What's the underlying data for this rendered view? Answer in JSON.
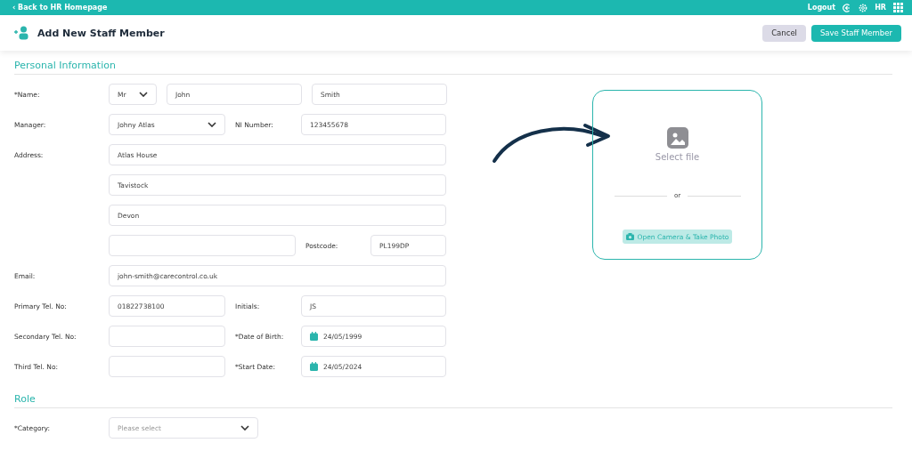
{
  "top_bar": {
    "back_link": "‹ Back to HR Homepage",
    "logout": "Logout",
    "user": "HR"
  },
  "header": {
    "title": "Add New Staff Member",
    "buttons": [
      {
        "label": "Cancel",
        "kind": "secondary"
      },
      {
        "label": "Save Staff Member",
        "kind": "primary"
      }
    ]
  },
  "sections": [
    {
      "title": "Personal Information",
      "rows": [
        {
          "kind": "name",
          "label": "*Name:",
          "fields": [
            {
              "kind": "select",
              "value": "Mr"
            },
            {
              "kind": "input",
              "value": "John"
            },
            {
              "kind": "input",
              "value": "Smith"
            }
          ]
        },
        {
          "kind": "pair",
          "label": "Manager:",
          "fields": [
            {
              "kind": "select",
              "value": "Johny Atlas"
            }
          ],
          "extra": {
            "label": "NI Number:",
            "field": {
              "kind": "input",
              "value": "123455678"
            }
          }
        },
        {
          "kind": "full",
          "label": "Address:",
          "fields": [
            {
              "kind": "input",
              "value": "Atlas House"
            }
          ]
        },
        {
          "kind": "full",
          "fields": [
            {
              "kind": "input",
              "value": "Tavistock"
            }
          ]
        },
        {
          "kind": "full",
          "fields": [
            {
              "kind": "input",
              "value": "Devon"
            }
          ]
        },
        {
          "kind": "postcode",
          "fields": [
            {
              "kind": "input"
            }
          ],
          "extra": {
            "label": "Postcode:",
            "field": {
              "kind": "input",
              "value": "PL199DP"
            }
          }
        },
        {
          "kind": "full",
          "label": "Email:",
          "fields": [
            {
              "kind": "input",
              "value": "john-smith@carecontrol.co.uk"
            }
          ]
        },
        {
          "kind": "pair",
          "label": "Primary Tel. No:",
          "fields": [
            {
              "kind": "input",
              "value": "01822738100"
            }
          ],
          "extra": {
            "label": "Initials:",
            "field": {
              "kind": "input",
              "value": "JS"
            }
          }
        },
        {
          "kind": "pair",
          "label": "Secondary Tel. No:",
          "fields": [
            {
              "kind": "input"
            }
          ],
          "extra": {
            "label": "*Date of Birth:",
            "field": {
              "kind": "date",
              "value": "24/05/1999"
            }
          }
        },
        {
          "kind": "pair",
          "label": "Third Tel. No:",
          "fields": [
            {
              "kind": "input"
            }
          ],
          "extra": {
            "label": "*Start Date:",
            "field": {
              "kind": "date",
              "value": "24/05/2024"
            }
          }
        }
      ]
    },
    {
      "title": "Role",
      "rows": [
        {
          "kind": "short",
          "label": "*Category:",
          "fields": [
            {
              "kind": "select",
              "placeholder": "Please select"
            }
          ]
        }
      ]
    }
  ],
  "upload": {
    "select_text": "Select file",
    "divider": "or",
    "camera_button": "Open Camera & Take Photo"
  }
}
